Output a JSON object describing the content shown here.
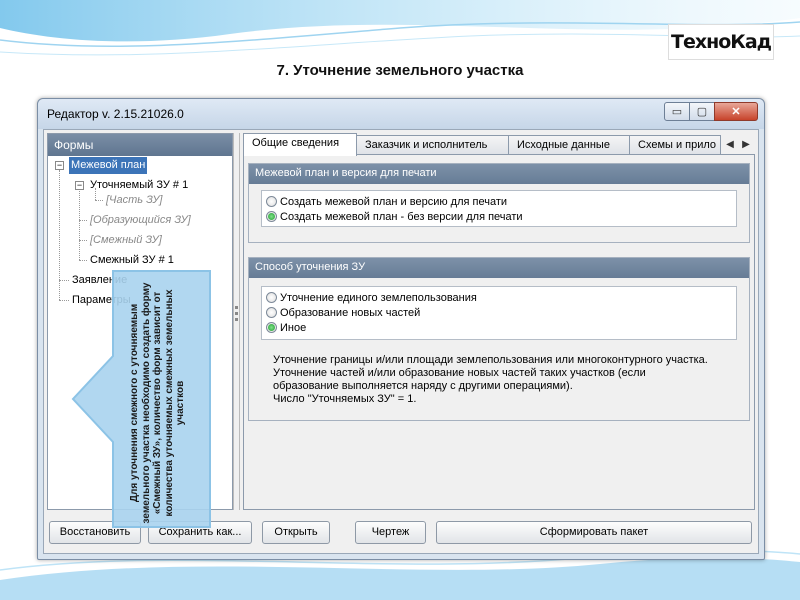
{
  "slide": {
    "title": "7. Уточнение земельного участка",
    "logo_text": "ТехноКад"
  },
  "window": {
    "title": "Редактор v. 2.15.21026.0",
    "controls": {
      "minimize": "▭",
      "maximize": "▢",
      "close": "✕"
    }
  },
  "forms_panel": {
    "header": "Формы",
    "tree": [
      {
        "label": "Межевой план",
        "selected": true
      },
      {
        "label": "Уточняемый ЗУ # 1"
      },
      {
        "label": "[Часть ЗУ]"
      },
      {
        "label": "[Образующийся ЗУ]"
      },
      {
        "label": "[Смежный ЗУ]"
      },
      {
        "label": "Смежный ЗУ # 1"
      },
      {
        "label": "Заявление"
      },
      {
        "label": "Параметры"
      }
    ]
  },
  "tabs": [
    "Общие сведения",
    "Заказчик и исполнитель",
    "Исходные данные",
    "Схемы и прило"
  ],
  "tab_scroll": {
    "left": "◀",
    "right": "▶"
  },
  "print_group": {
    "header": "Межевой план и версия для печати",
    "options": [
      {
        "label": "Создать межевой план и версию для печати",
        "checked": false
      },
      {
        "label": "Создать межевой план - без версии для печати",
        "checked": true
      }
    ]
  },
  "method_group": {
    "header": "Способ уточнения ЗУ",
    "options": [
      {
        "label": "Уточнение единого землепользования",
        "checked": false
      },
      {
        "label": "Образование новых частей",
        "checked": false
      },
      {
        "label": "Иное",
        "checked": true
      }
    ],
    "description": [
      "Уточнение границы и/или площади землепользования или многоконтурного участка.",
      "Уточнение частей и/или образование новых частей таких участков (если",
      "образование выполняется наряду с другими операциями).",
      "Число \"Уточняемых ЗУ\" = 1."
    ]
  },
  "buttons": {
    "restore": "Восстановить",
    "save_as": "Сохранить как...",
    "open": "Открыть",
    "drawing": "Чертеж",
    "generate": "Сформировать пакет"
  },
  "callout": {
    "text": "Для уточнения смежного с уточняемым земельного участка необходимо создать форму «Смежный ЗУ», количество форм зависит от количества уточняемых смежных земельных участков",
    "color": "#a9d3ee"
  }
}
